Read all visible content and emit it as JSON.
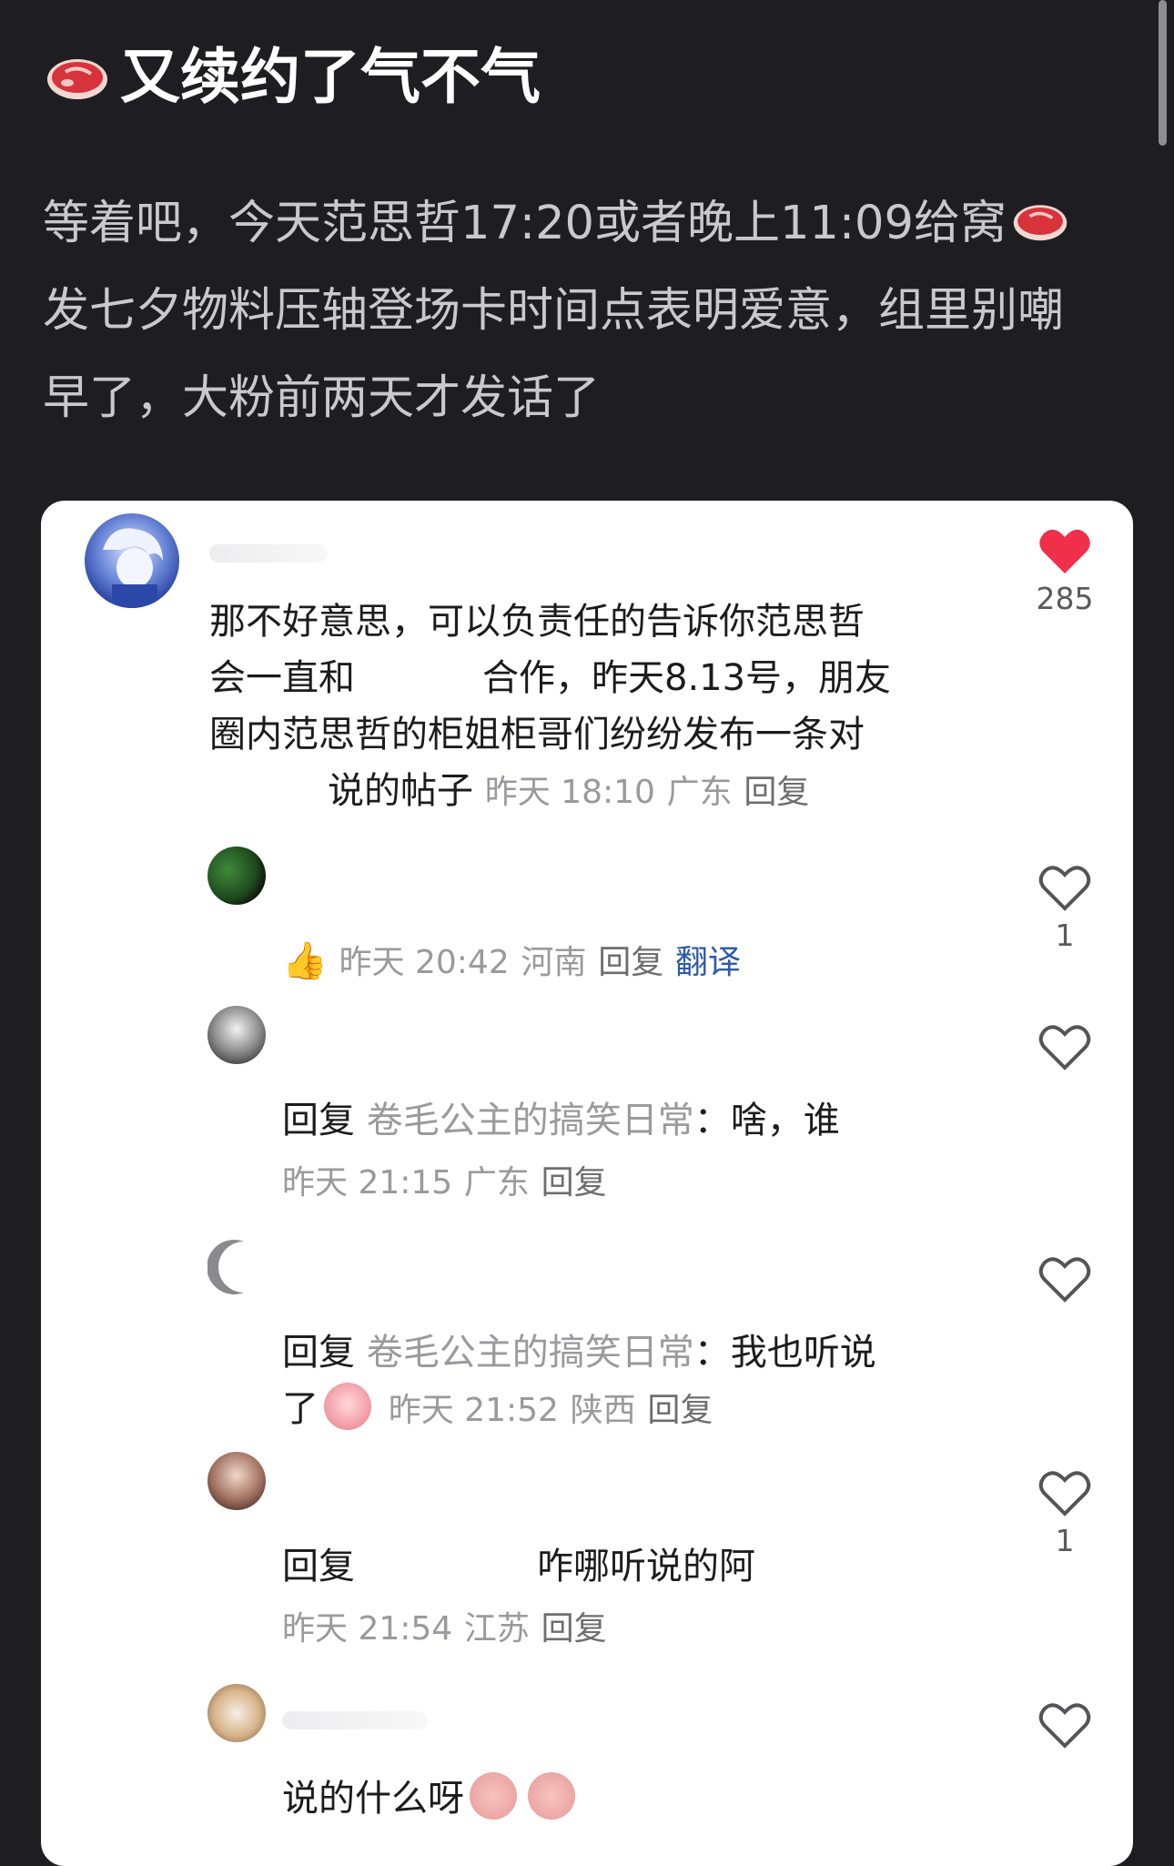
{
  "post": {
    "title": "又续约了气不气",
    "body_part1": "等着吧，今天范思哲17:20或者晚上11:09给窝",
    "body_part2": "发七夕物料压轴登场卡时间点表明爱意，组里别嘲早了，大粉前两天才发话了"
  },
  "main_comment": {
    "text_line1": "那不好意思，可以负责任的告诉你范思哲",
    "text_line2a": "会一直和",
    "text_line2b": "合作，昨天8.13号，朋友",
    "text_line3": "圈内范思哲的柜姐柜哥们纷纷发布一条对",
    "text_line4": "说的帖子",
    "time": "昨天 18:10",
    "location": "广东",
    "reply_label": "回复",
    "like_count": "285"
  },
  "replies": [
    {
      "emoji": "👍",
      "time": "昨天 20:42",
      "location": "河南",
      "reply_label": "回复",
      "translate_label": "翻译",
      "like_count": "1"
    },
    {
      "prefix": "回复",
      "target": "卷毛公主的搞笑日常",
      "text": "：啥，谁",
      "time": "昨天 21:15",
      "location": "广东",
      "reply_label": "回复",
      "like_count": ""
    },
    {
      "prefix": "回复",
      "target": "卷毛公主的搞笑日常",
      "text_line1": "：我也听说",
      "text_line2": "了",
      "time": "昨天 21:52",
      "location": "陕西",
      "reply_label": "回复",
      "like_count": ""
    },
    {
      "prefix": "回复",
      "text": "咋哪听说的阿",
      "time": "昨天 21:54",
      "location": "江苏",
      "reply_label": "回复",
      "like_count": "1"
    },
    {
      "text": "说的什么呀",
      "like_count": ""
    }
  ],
  "colors": {
    "background": "#1e1e22",
    "card": "#ffffff",
    "heart_active": "#f0304a",
    "link_blue": "#2c5aa8"
  },
  "icons": {
    "title_icon": "steak-icon",
    "like_icon": "heart-icon"
  }
}
